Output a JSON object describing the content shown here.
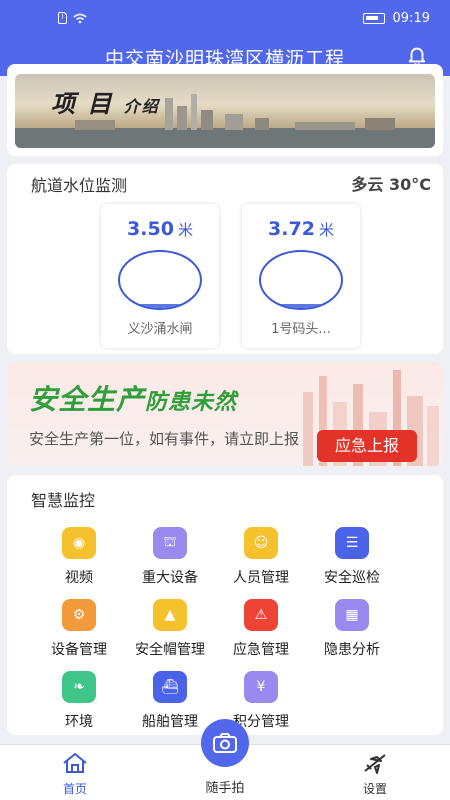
{
  "status_bar": {
    "time": "09:19"
  },
  "header": {
    "title": "中交南沙明珠湾区横沥工程"
  },
  "project_banner": {
    "title_big": "项 目",
    "title_small": "介绍"
  },
  "water_level": {
    "title": "航道水位监测",
    "weather": "多云 30°C",
    "unit": "米",
    "gauges": [
      {
        "value": "3.50",
        "name": "义沙涌水闸",
        "fill_fraction": 0.08
      },
      {
        "value": "3.72",
        "name": "1号码头..."
      }
    ]
  },
  "safety": {
    "slogan_main": "安全生产",
    "slogan_rest": "防患未然",
    "tip": "安全生产第一位，如有事件，请立即上报",
    "report_button": "应急上报"
  },
  "smart_monitor": {
    "title": "智慧监控",
    "items": [
      {
        "label": "视频",
        "icon": "video-icon",
        "color": "#f5c22e"
      },
      {
        "label": "重大设备",
        "icon": "crane-icon",
        "color": "#9a8af0"
      },
      {
        "label": "人员管理",
        "icon": "person-card-icon",
        "color": "#f5c22e"
      },
      {
        "label": "安全巡检",
        "icon": "inspection-icon",
        "color": "#4a63e8"
      },
      {
        "label": "设备管理",
        "icon": "equipment-icon",
        "color": "#f39a3a"
      },
      {
        "label": "安全帽管理",
        "icon": "helmet-icon",
        "color": "#f5c22e"
      },
      {
        "label": "应急管理",
        "icon": "alarm-icon",
        "color": "#ee4436"
      },
      {
        "label": "隐患分析",
        "icon": "analysis-icon",
        "color": "#9a8af0"
      },
      {
        "label": "环境",
        "icon": "leaf-icon",
        "color": "#3fc48a"
      },
      {
        "label": "船舶管理",
        "icon": "ship-icon",
        "color": "#4a63e8"
      },
      {
        "label": "积分管理",
        "icon": "points-icon",
        "color": "#9a8af0"
      }
    ]
  },
  "tabbar": {
    "home": "首页",
    "camera": "随手拍",
    "settings": "设置",
    "active_color": "#3c59d6"
  }
}
